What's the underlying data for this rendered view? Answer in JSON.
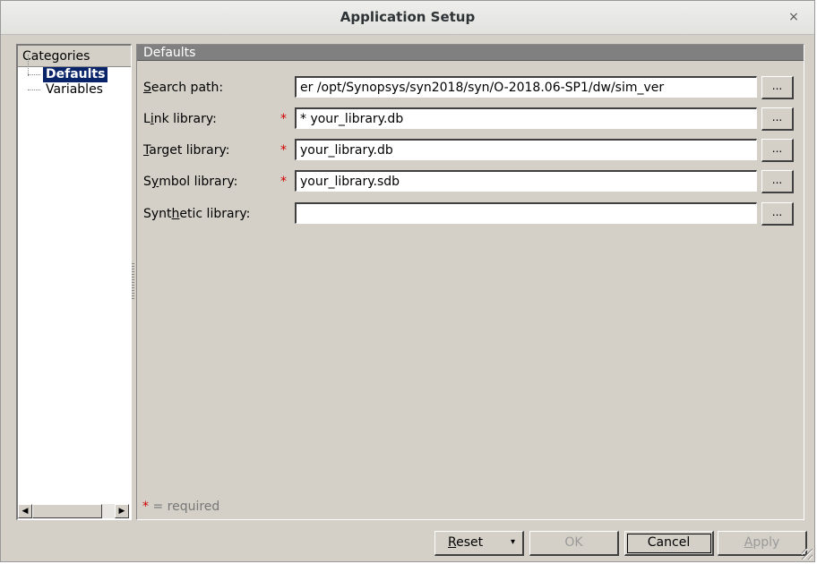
{
  "window": {
    "title": "Application Setup",
    "close_glyph": "×"
  },
  "categories": {
    "header": "Categories",
    "items": [
      {
        "label": "Defaults",
        "selected": true
      },
      {
        "label": "Variables",
        "selected": false
      }
    ]
  },
  "section": {
    "title": "Defaults"
  },
  "fields": [
    {
      "label_pre": "",
      "label_u": "S",
      "label_post": "earch path:",
      "required": false,
      "value": "er /opt/Synopsys/syn2018/syn/O-2018.06-SP1/dw/sim_ver",
      "browse": "..."
    },
    {
      "label_pre": "L",
      "label_u": "i",
      "label_post": "nk library:",
      "required": true,
      "value": "* your_library.db",
      "browse": "..."
    },
    {
      "label_pre": "",
      "label_u": "T",
      "label_post": "arget library:",
      "required": true,
      "value": "your_library.db",
      "browse": "..."
    },
    {
      "label_pre": "S",
      "label_u": "y",
      "label_post": "mbol library:",
      "required": true,
      "value": "your_library.sdb",
      "browse": "..."
    },
    {
      "label_pre": "Synt",
      "label_u": "h",
      "label_post": "etic library:",
      "required": false,
      "value": "",
      "browse": "..."
    }
  ],
  "required_note": {
    "star": "*",
    "text": " = required"
  },
  "required_star": "*",
  "buttons": {
    "reset": {
      "u": "R",
      "rest": "eset",
      "arrow": "▾"
    },
    "ok": "OK",
    "cancel": "Cancel",
    "apply": {
      "u": "A",
      "rest": "pply"
    }
  },
  "scroll": {
    "left_arrow": "◀",
    "right_arrow": "▶"
  },
  "colors": {
    "selection": "#0a246a",
    "required": "#d00000",
    "section_bar": "#808080",
    "face": "#d4d0c8"
  }
}
